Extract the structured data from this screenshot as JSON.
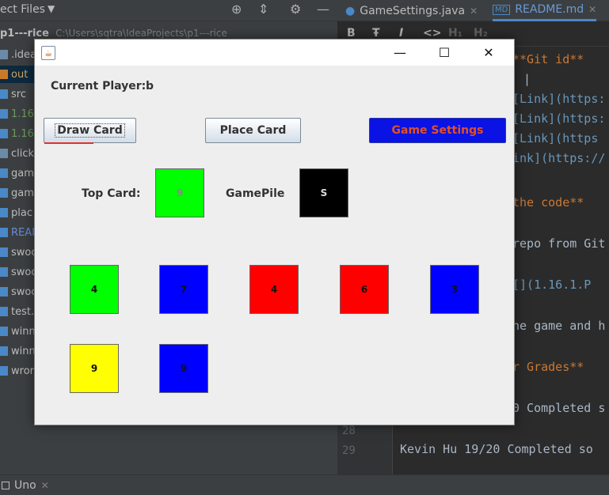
{
  "ide": {
    "project_title": "ect Files",
    "project_root_name": "p1---rice",
    "project_root_path": "C:\\Users\\sqtra\\IdeaProjects\\p1---rice",
    "tree": [
      {
        "label": ".idea",
        "color": "#bbbbbb",
        "icon": "#6a8aa8"
      },
      {
        "label": "out",
        "color": "#d0a060",
        "icon": "#c87a2a",
        "selected": true
      },
      {
        "label": "src",
        "color": "#bbbbbb",
        "icon": "#4a88c7"
      },
      {
        "label": "1.16.",
        "color": "#6a9a5a",
        "icon": "#4a88c7"
      },
      {
        "label": "1.16.",
        "color": "#6a9a5a",
        "icon": "#4a88c7"
      },
      {
        "label": "click",
        "color": "#bbbbbb",
        "icon": "#6a8aa8"
      },
      {
        "label": "gam",
        "color": "#bbbbbb",
        "icon": "#4a88c7"
      },
      {
        "label": "gam",
        "color": "#bbbbbb",
        "icon": "#4a88c7"
      },
      {
        "label": "plac",
        "color": "#bbbbbb",
        "icon": "#4a88c7"
      },
      {
        "label": "REAI",
        "color": "#6a8ad8",
        "icon": "#4a88c7"
      },
      {
        "label": "swoo",
        "color": "#bbbbbb",
        "icon": "#4a88c7"
      },
      {
        "label": "swoo",
        "color": "#bbbbbb",
        "icon": "#4a88c7"
      },
      {
        "label": "swoo",
        "color": "#bbbbbb",
        "icon": "#4a88c7"
      },
      {
        "label": "test.",
        "color": "#bbbbbb",
        "icon": "#4a88c7"
      },
      {
        "label": "winn",
        "color": "#bbbbbb",
        "icon": "#4a88c7"
      },
      {
        "label": "winn",
        "color": "#bbbbbb",
        "icon": "#4a88c7"
      },
      {
        "label": "wror",
        "color": "#bbbbbb",
        "icon": "#4a88c7"
      }
    ],
    "tabs": [
      {
        "label": "GameSettings.java",
        "active": false
      },
      {
        "label": "README.md",
        "active": true
      }
    ],
    "toolbar_glyphs": [
      "B",
      "Ŧ",
      "I",
      "<>",
      "H₁",
      "H₂"
    ],
    "line_numbers": [
      "28",
      "29"
    ],
    "code_lines": [
      {
        "text": "**Git id**",
        "color": "#cc7832"
      },
      {
        "text": "|",
        "color": "#a9b7c6"
      },
      {
        "text": "[Link](https:",
        "color": "#6897bb"
      },
      {
        "text": "[Link](https:",
        "color": "#6897bb"
      },
      {
        "text": "[Link](https",
        "color": "#6897bb"
      },
      {
        "text": "ink](https://",
        "color": "#6897bb"
      },
      {
        "text": "the code**",
        "color": "#cc7832"
      },
      {
        "text": "repo from Git",
        "color": "#a9b7c6"
      },
      {
        "text": "[](1.16.1.P",
        "color": "#6897bb"
      },
      {
        "text": "he game and h",
        "color": "#a9b7c6"
      },
      {
        "text": "r Grades**",
        "color": "#cc7832"
      },
      {
        "text": "0 Completed s",
        "color": "#a9b7c6"
      },
      {
        "text": "Kevin Hu 19/20 Completed so",
        "color": "#a9b7c6"
      }
    ],
    "bottom_tab": "Uno"
  },
  "window": {
    "current_player_label": "Current Player:",
    "current_player_value": "b",
    "buttons": {
      "draw": "Draw Card",
      "place": "Place Card",
      "settings": "Game Settings"
    },
    "top_card_label": "Top Card:",
    "top_card": {
      "value": "9",
      "color": "#00ff00",
      "text_color": "#888888"
    },
    "game_pile_label": "GamePile",
    "game_pile": {
      "value": "S",
      "color": "#000000",
      "text_color": "#dddddd"
    },
    "hand": [
      {
        "value": "4",
        "color": "#00ff00"
      },
      {
        "value": "7",
        "color": "#0000ff"
      },
      {
        "value": "4",
        "color": "#ff0000"
      },
      {
        "value": "6",
        "color": "#ff0000"
      },
      {
        "value": "3",
        "color": "#0000ff"
      },
      {
        "value": "9",
        "color": "#ffff00"
      },
      {
        "value": "9",
        "color": "#0000ff"
      }
    ]
  }
}
